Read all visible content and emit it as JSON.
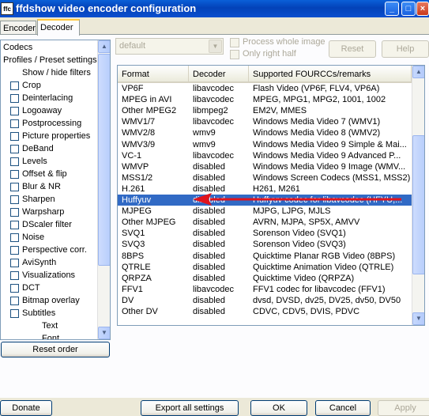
{
  "window": {
    "title": "ffdshow video encoder configuration",
    "icon_label": "ffc"
  },
  "tabs": [
    {
      "label": "Encoder"
    },
    {
      "label": "Decoder"
    }
  ],
  "sidebar": {
    "items": [
      {
        "label": "Codecs",
        "checkbox": false,
        "indent": 0
      },
      {
        "label": "Profiles / Preset settings",
        "checkbox": false,
        "indent": 0
      },
      {
        "label": "Show / hide filters",
        "checkbox": false,
        "indent": 2
      },
      {
        "label": "Crop",
        "checkbox": true,
        "indent": 1
      },
      {
        "label": "Deinterlacing",
        "checkbox": true,
        "indent": 1
      },
      {
        "label": "Logoaway",
        "checkbox": true,
        "indent": 1
      },
      {
        "label": "Postprocessing",
        "checkbox": true,
        "indent": 1
      },
      {
        "label": "Picture properties",
        "checkbox": true,
        "indent": 1
      },
      {
        "label": "DeBand",
        "checkbox": true,
        "indent": 1
      },
      {
        "label": "Levels",
        "checkbox": true,
        "indent": 1
      },
      {
        "label": "Offset & flip",
        "checkbox": true,
        "indent": 1
      },
      {
        "label": "Blur & NR",
        "checkbox": true,
        "indent": 1
      },
      {
        "label": "Sharpen",
        "checkbox": true,
        "indent": 1
      },
      {
        "label": "Warpsharp",
        "checkbox": true,
        "indent": 1
      },
      {
        "label": "DScaler filter",
        "checkbox": true,
        "indent": 1
      },
      {
        "label": "Noise",
        "checkbox": true,
        "indent": 1
      },
      {
        "label": "Perspective corr.",
        "checkbox": true,
        "indent": 1
      },
      {
        "label": "AviSynth",
        "checkbox": true,
        "indent": 1
      },
      {
        "label": "Visualizations",
        "checkbox": true,
        "indent": 1
      },
      {
        "label": "DCT",
        "checkbox": true,
        "indent": 1
      },
      {
        "label": "Bitmap overlay",
        "checkbox": true,
        "indent": 1
      },
      {
        "label": "Subtitles",
        "checkbox": true,
        "indent": 1
      },
      {
        "label": "Text",
        "checkbox": false,
        "indent": 3
      },
      {
        "label": "Font",
        "checkbox": false,
        "indent": 3
      }
    ],
    "reset_order_label": "Reset order"
  },
  "controls": {
    "preset_value": "default",
    "process_whole_image": "Process whole image",
    "only_right_half": "Only right half",
    "reset_label": "Reset",
    "help_label": "Help"
  },
  "table": {
    "headers": [
      "Format",
      "Decoder",
      "Supported FOURCCs/remarks"
    ],
    "rows": [
      {
        "format": "VP6F",
        "decoder": "libavcodec",
        "remarks": "Flash Video (VP6F, FLV4, VP6A)"
      },
      {
        "format": "MPEG in AVI",
        "decoder": "libavcodec",
        "remarks": "MPEG, MPG1, MPG2, 1001, 1002"
      },
      {
        "format": "Other MPEG2",
        "decoder": "libmpeg2",
        "remarks": "EM2V, MMES"
      },
      {
        "format": "WMV1/7",
        "decoder": "libavcodec",
        "remarks": "Windows Media Video 7 (WMV1)"
      },
      {
        "format": "WMV2/8",
        "decoder": "wmv9",
        "remarks": "Windows Media Video 8 (WMV2)"
      },
      {
        "format": "WMV3/9",
        "decoder": "wmv9",
        "remarks": "Windows Media Video 9 Simple & Mai..."
      },
      {
        "format": "VC-1",
        "decoder": "libavcodec",
        "remarks": "Windows Media Video 9 Advanced P..."
      },
      {
        "format": "WMVP",
        "decoder": "disabled",
        "remarks": "Windows Media Video 9 Image (WMV..."
      },
      {
        "format": "MSS1/2",
        "decoder": "disabled",
        "remarks": "Windows Screen Codecs (MSS1, MSS2)"
      },
      {
        "format": "H.261",
        "decoder": "disabled",
        "remarks": "H261, M261"
      },
      {
        "format": "Huffyuv",
        "decoder": "disabled",
        "remarks": "Huffyuv codec for libavcodec (HFYU,..."
      },
      {
        "format": "MJPEG",
        "decoder": "disabled",
        "remarks": "MJPG, LJPG, MJLS"
      },
      {
        "format": "Other MJPEG",
        "decoder": "disabled",
        "remarks": "AVRN, MJPA, SP5X, AMVV"
      },
      {
        "format": "SVQ1",
        "decoder": "disabled",
        "remarks": "Sorenson Video (SVQ1)"
      },
      {
        "format": "SVQ3",
        "decoder": "disabled",
        "remarks": "Sorenson Video (SVQ3)"
      },
      {
        "format": "8BPS",
        "decoder": "disabled",
        "remarks": "Quicktime Planar RGB Video (8BPS)"
      },
      {
        "format": "QTRLE",
        "decoder": "disabled",
        "remarks": "Quicktime Animation Video (QTRLE)"
      },
      {
        "format": "QRPZA",
        "decoder": "disabled",
        "remarks": "Quicktime Video (QRPZA)"
      },
      {
        "format": "FFV1",
        "decoder": "libavcodec",
        "remarks": "FFV1 codec for libavcodec (FFV1)"
      },
      {
        "format": "DV",
        "decoder": "disabled",
        "remarks": "dvsd, DVSD, dv25, DV25, dv50, DV50"
      },
      {
        "format": "Other DV",
        "decoder": "disabled",
        "remarks": "CDVC, CDV5, DVIS, PDVC"
      }
    ],
    "selected_index": 10
  },
  "footer": {
    "donate": "Donate",
    "export": "Export all settings",
    "ok": "OK",
    "cancel": "Cancel",
    "apply": "Apply"
  },
  "colors": {
    "selection": "#316ac5",
    "annotation_arrow": "#e0141e",
    "titlebar": "#0342b8"
  }
}
